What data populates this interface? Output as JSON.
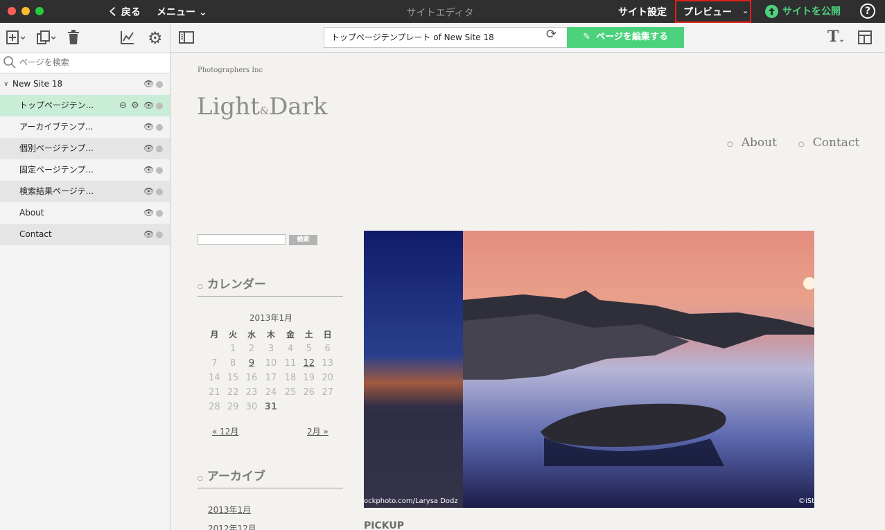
{
  "titlebar": {
    "back_label": "く 戻る",
    "menu_label": "メニュー ⌄",
    "title": "サイトエディタ",
    "site_settings": "サイト設定",
    "preview": "プレビュー",
    "preview_caret": "⌄",
    "publish": "サイトを公開",
    "help": "?"
  },
  "sidebar": {
    "search_placeholder": "ページを検索",
    "root": "New Site 18",
    "items": [
      {
        "label": "トップページテン..."
      },
      {
        "label": "アーカイブテンプ..."
      },
      {
        "label": "個別ページテンプ..."
      },
      {
        "label": "固定ページテンプ..."
      },
      {
        "label": "検索結果ページテ..."
      },
      {
        "label": "About"
      },
      {
        "label": "Contact"
      }
    ]
  },
  "toolbar": {
    "url": "トップページテンプレート of New Site 18",
    "edit_button": "ページを編集する"
  },
  "page": {
    "company": "Photographers Inc",
    "logo_light": "Light",
    "logo_amp": "&",
    "logo_dark": "Dark",
    "nav": [
      "About",
      "Contact"
    ],
    "search_button": "検索",
    "calendar_title": "カレンダー",
    "calendar_caption": "2013年1月",
    "weekdays": [
      "月",
      "火",
      "水",
      "木",
      "金",
      "土",
      "日"
    ],
    "calendar_rows": [
      [
        "",
        "1",
        "2",
        "3",
        "4",
        "5",
        "6"
      ],
      [
        "7",
        "8",
        "9",
        "10",
        "11",
        "12",
        "13"
      ],
      [
        "14",
        "15",
        "16",
        "17",
        "18",
        "19",
        "20"
      ],
      [
        "21",
        "22",
        "23",
        "24",
        "25",
        "26",
        "27"
      ],
      [
        "28",
        "29",
        "30",
        "31",
        "",
        "",
        ""
      ]
    ],
    "prev_month": "« 12月",
    "next_month": "2月 »",
    "archive_title": "アーカイブ",
    "archives": [
      "2013年1月",
      "2012年12月"
    ],
    "hero_credit_left": "ockphoto.com/Larysa Dodz",
    "hero_credit_right": "©iSt",
    "pickup": "PICKUP"
  },
  "colors": {
    "accent_green": "#4cd27d",
    "highlight_red": "#e0201a",
    "selected_row": "#c9edd7"
  }
}
